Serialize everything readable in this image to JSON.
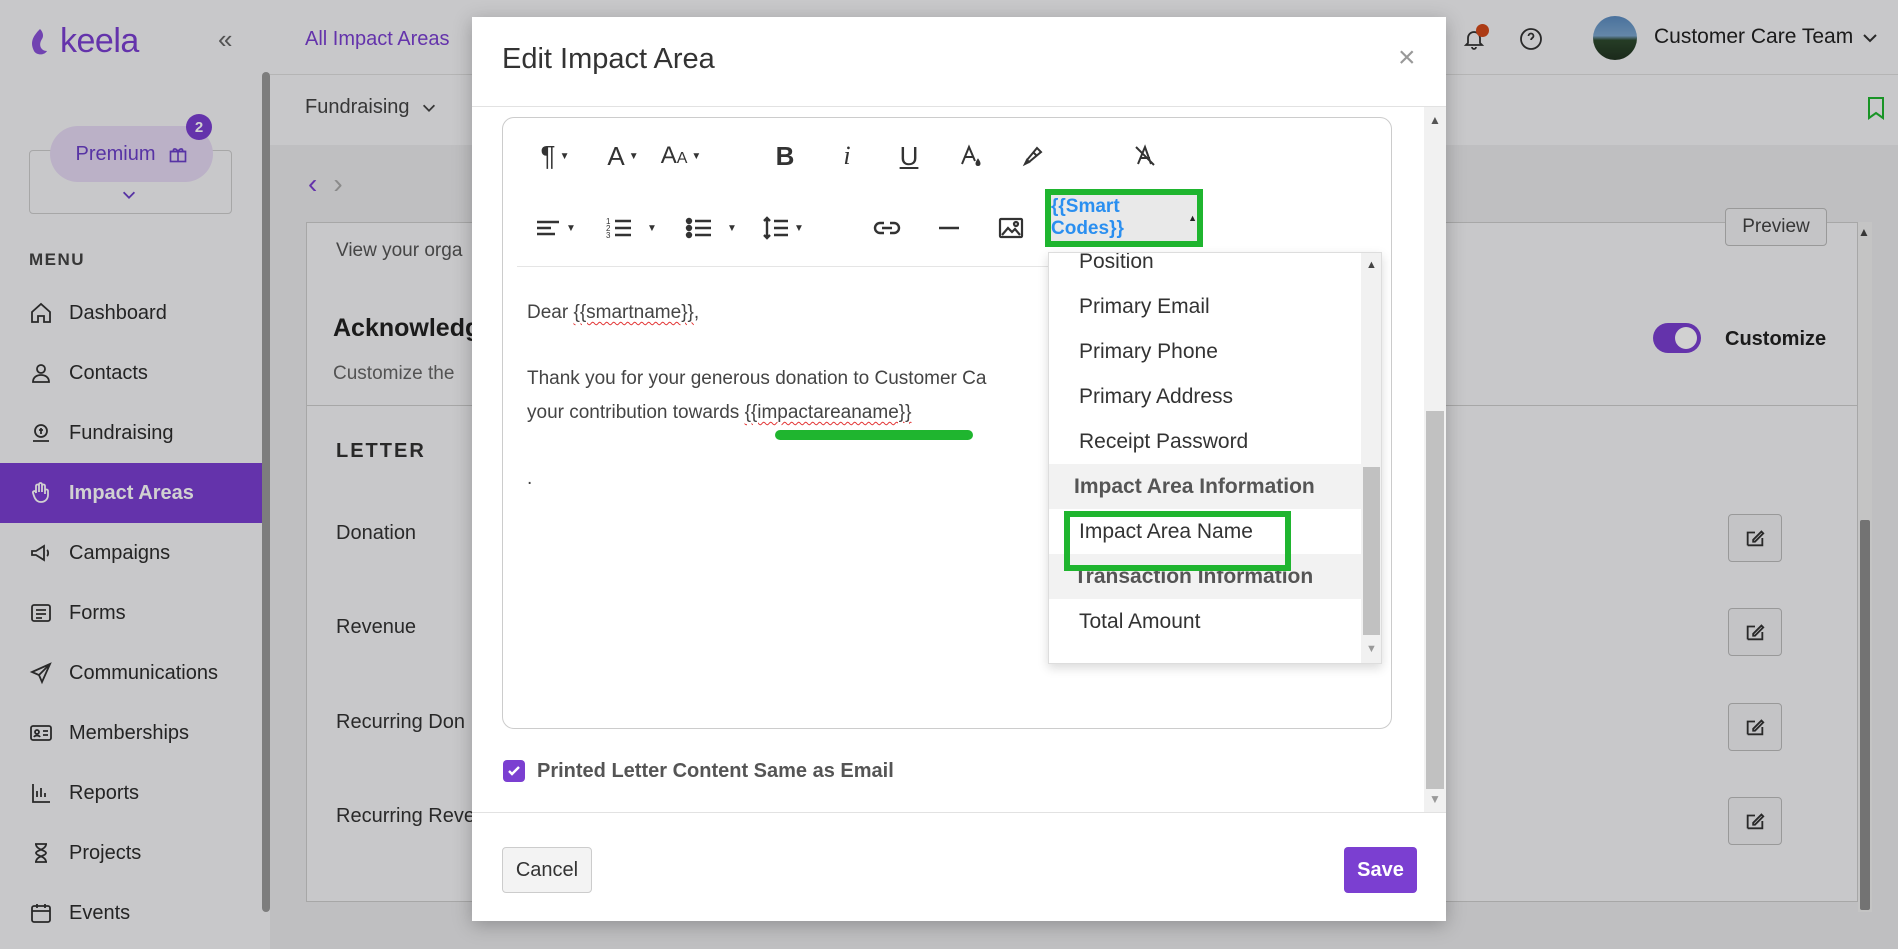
{
  "app": {
    "logo_text": "keela",
    "brand_color": "#7b3fd1",
    "highlight_color": "#1fb52f"
  },
  "sidebar": {
    "premium_label": "Premium",
    "premium_badge": "2",
    "menu_label": "MENU",
    "items": [
      {
        "label": "Dashboard",
        "icon": "home-icon"
      },
      {
        "label": "Contacts",
        "icon": "person-icon"
      },
      {
        "label": "Fundraising",
        "icon": "donation-icon"
      },
      {
        "label": "Impact Areas",
        "icon": "hand-icon",
        "active": true
      },
      {
        "label": "Campaigns",
        "icon": "megaphone-icon"
      },
      {
        "label": "Forms",
        "icon": "list-icon"
      },
      {
        "label": "Communications",
        "icon": "send-icon"
      },
      {
        "label": "Memberships",
        "icon": "id-card-icon"
      },
      {
        "label": "Reports",
        "icon": "chart-icon"
      },
      {
        "label": "Projects",
        "icon": "hourglass-icon"
      },
      {
        "label": "Events",
        "icon": "calendar-icon"
      }
    ]
  },
  "topbar": {
    "tab": "All Impact Areas",
    "user_name": "Customer Care Team"
  },
  "subbar": {
    "tab": "Fundraising"
  },
  "background": {
    "description": "View your orga",
    "preview_label": "Preview",
    "ack_title": "Acknowledg",
    "ack_desc": "Customize the",
    "customize_label": "Customize",
    "letter_heading": "LETTER",
    "rows": [
      "Donation",
      "Revenue",
      "Recurring Don",
      "Recurring Reve"
    ]
  },
  "modal": {
    "title": "Edit Impact Area",
    "close": "×",
    "smart_codes_label": "{{Smart Codes}}",
    "body": {
      "greeting_prefix": "Dear ",
      "greeting_code": "{{smartname}}",
      "greeting_suffix": ",",
      "line1": "Thank you for your generous donation to Customer Ca",
      "line2_prefix": "your contribution towards ",
      "line2_code": "{{impactareaname}}",
      "line3": "."
    },
    "dropdown": {
      "items": [
        "Position",
        "Primary Email",
        "Primary Phone",
        "Primary Address",
        "Receipt Password"
      ],
      "group1": "Impact Area Information",
      "group1_items": [
        "Impact Area Name"
      ],
      "group2": "Transaction Information",
      "group2_items": [
        "Total Amount"
      ]
    },
    "checkbox_label": "Printed Letter Content Same as Email",
    "checkbox_checked": true,
    "cancel_label": "Cancel",
    "save_label": "Save"
  }
}
